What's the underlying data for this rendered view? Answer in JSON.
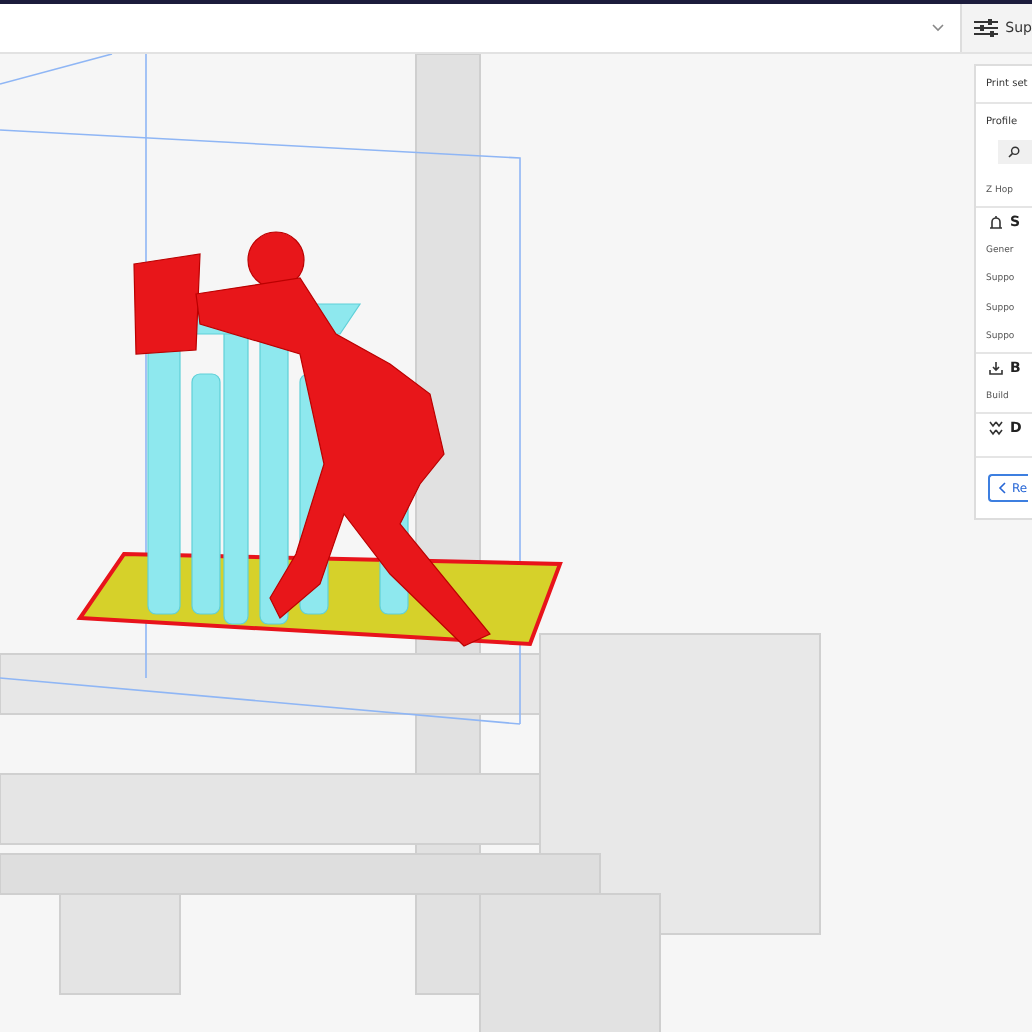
{
  "toolbar": {
    "settings_button": {
      "label": "Sup"
    }
  },
  "print_settings": {
    "title": "Print set",
    "profile_label": "Profile",
    "rows": [
      {
        "kind": "setting",
        "label": "Z Hop"
      },
      {
        "kind": "category",
        "label": "S"
      },
      {
        "kind": "setting",
        "label": "Gener"
      },
      {
        "kind": "setting",
        "label": "Suppo"
      },
      {
        "kind": "setting",
        "label": "Suppo"
      },
      {
        "kind": "setting",
        "label": "Suppo"
      },
      {
        "kind": "category",
        "label": "B"
      },
      {
        "kind": "setting",
        "label": "Build"
      },
      {
        "kind": "category",
        "label": "D"
      }
    ],
    "back_button": {
      "label": "Re"
    }
  }
}
